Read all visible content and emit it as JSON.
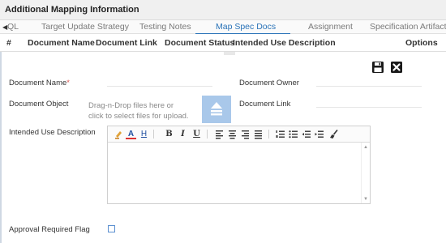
{
  "window": {
    "title": "Additional Mapping Information"
  },
  "tabs": {
    "items": [
      {
        "label": "QL"
      },
      {
        "label": "Target Update Strategy"
      },
      {
        "label": "Testing Notes"
      },
      {
        "label": "Map Spec Docs",
        "active": true
      },
      {
        "label": "Assignment"
      },
      {
        "label": "Specification Artifacts"
      }
    ]
  },
  "grid": {
    "columns": [
      "#",
      "Document Name",
      "Document Link",
      "Document Status",
      "Intended Use Description",
      "Options"
    ]
  },
  "form": {
    "document_name_label": "Document Name",
    "document_name_required": "*",
    "document_owner_label": "Document Owner",
    "document_object_label": "Document Object",
    "drop_text_line1": "Drag-n-Drop files here or",
    "drop_text_line2": "click to select files for upload.",
    "document_link_label": "Document Link",
    "intended_use_label": "Intended Use Description",
    "approval_label": "Approval Required Flag",
    "approval_checked": false
  },
  "editor": {
    "toolbar": [
      "highlight-icon",
      "font-color-icon",
      "heading-icon",
      "bold-icon",
      "italic-icon",
      "underline-icon",
      "align-left-icon",
      "align-center-icon",
      "align-right-icon",
      "align-justify-icon",
      "ordered-list-icon",
      "unordered-list-icon",
      "outdent-icon",
      "indent-icon",
      "clear-format-icon"
    ],
    "bold_glyph": "B",
    "italic_glyph": "I",
    "underline_glyph": "U",
    "font_color_glyph": "A",
    "heading_glyph": "H"
  },
  "colors": {
    "accent": "#2a73b8",
    "upload_button": "#a9c8ea",
    "required": "#d9534f"
  }
}
